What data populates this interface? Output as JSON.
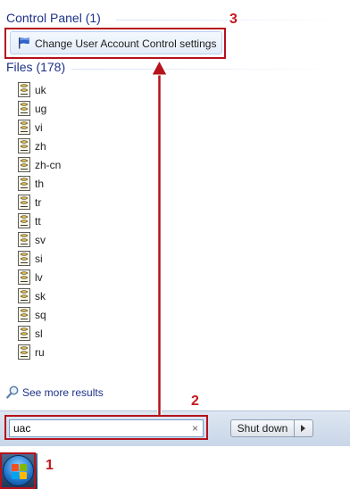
{
  "control_panel": {
    "header": "Control Panel (1)",
    "items": [
      {
        "label": "Change User Account Control settings",
        "icon": "uac-flag-icon"
      }
    ]
  },
  "files": {
    "header": "Files (178)",
    "items": [
      "uk",
      "ug",
      "vi",
      "zh",
      "zh-cn",
      "th",
      "tr",
      "tt",
      "sv",
      "si",
      "lv",
      "sk",
      "sq",
      "sl",
      "ru"
    ]
  },
  "see_more": {
    "label": "See more results",
    "icon": "magnifier-icon"
  },
  "search": {
    "value": "uac",
    "clear_glyph": "×"
  },
  "shutdown": {
    "label": "Shut down",
    "arrow_icon": "triangle-right-icon"
  },
  "taskbar": {
    "start_icon": "windows-start-orb-icon"
  },
  "annotations": {
    "step1": "1",
    "step2": "2",
    "step3": "3"
  },
  "colors": {
    "annotation": "#b5121b",
    "header": "#1e3287",
    "selection": "#e3edf9"
  }
}
